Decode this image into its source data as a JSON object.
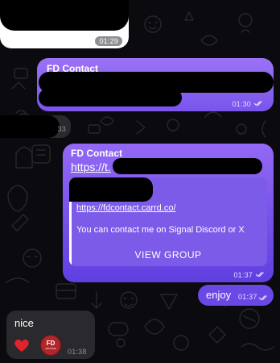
{
  "colors": {
    "background": "#0b0b0f",
    "incoming_bubble": "#2a2a2e",
    "outgoing_top": "#9b72f5",
    "outgoing_bottom": "#5f3fe0",
    "preview_card": "#7b5be8",
    "link_preview_text": "#ffffff",
    "reaction_badge": "#b0262b"
  },
  "messages": [
    {
      "id": "m1",
      "time": "01:29"
    },
    {
      "id": "m2",
      "sender": "FD Contact",
      "time": "01:30",
      "status_icon": "double-check-icon"
    },
    {
      "id": "m3",
      "time_partial": "33"
    },
    {
      "id": "m4",
      "sender": "FD Contact",
      "link_fragment": "https://t.",
      "preview": {
        "url": "https://fdcontact.carrd.co/",
        "description": "You can contact me on Signal Discord or X",
        "action": "VIEW GROUP"
      },
      "time": "01:37",
      "status_icon": "double-check-icon"
    },
    {
      "id": "m5",
      "text": "enjoy",
      "time": "01:37",
      "status_icon": "double-check-icon"
    },
    {
      "id": "m6",
      "text": "nice",
      "time": "01:38",
      "reactions": [
        {
          "icon": "heart-icon"
        },
        {
          "icon": "fd-archive-sticker",
          "line1": "FD",
          "line2": "ARCHIVE"
        }
      ]
    }
  ]
}
